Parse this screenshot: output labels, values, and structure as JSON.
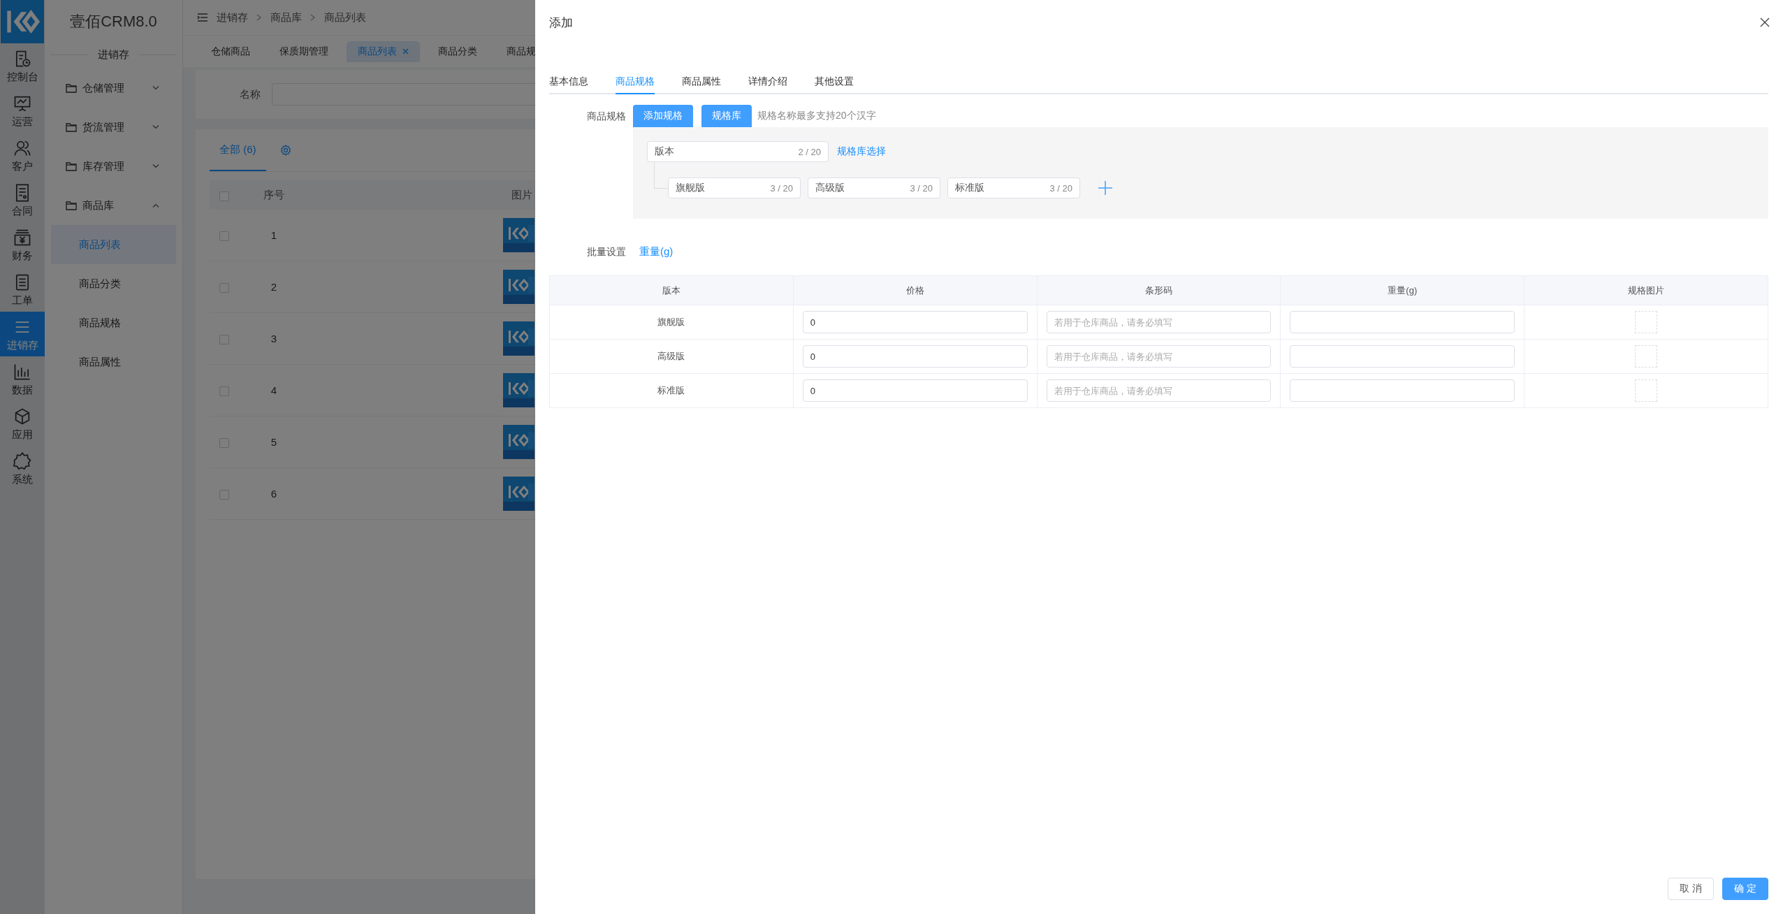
{
  "rail": {
    "items": [
      {
        "label": "控制台",
        "selected": false
      },
      {
        "label": "运营",
        "selected": false
      },
      {
        "label": "客户",
        "selected": false
      },
      {
        "label": "合同",
        "selected": false
      },
      {
        "label": "财务",
        "selected": false
      },
      {
        "label": "工单",
        "selected": false
      },
      {
        "label": "进销存",
        "selected": true
      },
      {
        "label": "数据",
        "selected": false
      },
      {
        "label": "应用",
        "selected": false
      },
      {
        "label": "系统",
        "selected": false
      }
    ]
  },
  "menu": {
    "title": "壹佰CRM8.0",
    "section": "进销存",
    "groups": [
      {
        "label": "仓储管理",
        "expanded": false
      },
      {
        "label": "货流管理",
        "expanded": false
      },
      {
        "label": "库存管理",
        "expanded": false
      },
      {
        "label": "商品库",
        "expanded": true,
        "children": [
          {
            "label": "商品列表",
            "selected": true
          },
          {
            "label": "商品分类",
            "selected": false
          },
          {
            "label": "商品规格",
            "selected": false
          },
          {
            "label": "商品属性",
            "selected": false
          }
        ]
      }
    ]
  },
  "breadcrumb": [
    "进销存",
    "商品库",
    "商品列表"
  ],
  "page_tabs": [
    {
      "label": "仓储商品",
      "selected": false
    },
    {
      "label": "保质期管理",
      "selected": false
    },
    {
      "label": "商品列表",
      "selected": true
    },
    {
      "label": "商品分类",
      "selected": false
    },
    {
      "label": "商品规",
      "selected": false
    }
  ],
  "filter": {
    "label": "名称"
  },
  "list_tabs": [
    {
      "label": "全部 (6)",
      "selected": true
    }
  ],
  "table": {
    "all_checked": false,
    "columns": [
      "序号",
      "图片"
    ],
    "rows": [
      {
        "index": "1",
        "checked": false
      },
      {
        "index": "2",
        "checked": false
      },
      {
        "index": "3",
        "checked": false
      },
      {
        "index": "4",
        "checked": false
      },
      {
        "index": "5",
        "checked": false
      },
      {
        "index": "6",
        "checked": false
      }
    ]
  },
  "drawer": {
    "title": "添加",
    "tabs": [
      {
        "label": "基本信息",
        "selected": false
      },
      {
        "label": "商品规格",
        "selected": true
      },
      {
        "label": "商品属性",
        "selected": false
      },
      {
        "label": "详情介绍",
        "selected": false
      },
      {
        "label": "其他设置",
        "selected": false
      }
    ],
    "spec": {
      "label": "商品规格",
      "buttons": [
        "添加规格",
        "规格库"
      ],
      "hint": "规格名称最多支持20个汉字",
      "groups": [
        {
          "name": "版本",
          "counter": "2 / 20",
          "link": "规格库选择",
          "values": [
            {
              "value": "旗舰版",
              "counter": "3 / 20"
            },
            {
              "value": "高级版",
              "counter": "3 / 20"
            },
            {
              "value": "标准版",
              "counter": "3 / 20"
            }
          ]
        }
      ]
    },
    "batch": {
      "label": "批量设置",
      "links": [
        "重量(g)"
      ]
    },
    "sku_table": {
      "columns": [
        "版本",
        "价格",
        "条形码",
        "重量(g)",
        "规格图片"
      ],
      "rows": [
        {
          "version": "旗舰版",
          "price": "0",
          "barcode_placeholder": "若用于仓库商品，请务必填写"
        },
        {
          "version": "高级版",
          "price": "0",
          "barcode_placeholder": "若用于仓库商品，请务必填写"
        },
        {
          "version": "标准版",
          "price": "0",
          "barcode_placeholder": "若用于仓库商品，请务必填写"
        }
      ]
    },
    "footer": {
      "buttons": [
        {
          "label": "取消",
          "kind": "default"
        },
        {
          "label": "确定",
          "kind": "primary"
        }
      ]
    }
  }
}
